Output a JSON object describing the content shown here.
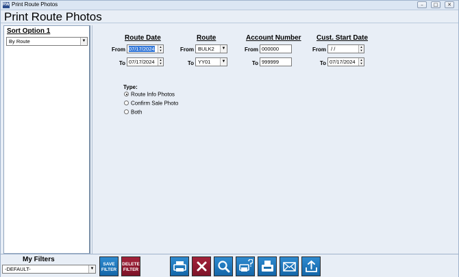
{
  "window": {
    "title": "Print Route Photos",
    "app_icon_text": "RW"
  },
  "page": {
    "title": "Print Route Photos"
  },
  "sort": {
    "label": "Sort Option 1",
    "selected": "By Route"
  },
  "criteria": {
    "route_date": {
      "heading": "Route Date",
      "from_label": "From",
      "to_label": "To",
      "from": "07/17/2024",
      "to": "07/17/2024"
    },
    "route": {
      "heading": "Route",
      "from_label": "From",
      "to_label": "To",
      "from": "BULK2",
      "to": "YY01"
    },
    "account": {
      "heading": "Account Number",
      "from_label": "From",
      "to_label": "To",
      "from": "000000",
      "to": "999999"
    },
    "cust_start": {
      "heading": "Cust. Start Date",
      "from_label": "From",
      "to_label": "To",
      "from": " / /",
      "to": "07/17/2024"
    }
  },
  "type": {
    "label": "Type:",
    "options": [
      "Route Info Photos",
      "Confirm Sale Photo",
      "Both"
    ],
    "selected_index": 0
  },
  "filters": {
    "label": "My Filters",
    "selected": "-DEFAULT-",
    "save_line1": "SAVE",
    "save_line2": "FILTER",
    "delete_line1": "DELETE",
    "delete_line2": "FILTER"
  },
  "toolbar": {
    "icons": [
      "print-icon",
      "cancel-icon",
      "preview-icon",
      "print-setup-icon",
      "fax-icon",
      "email-icon",
      "export-icon"
    ]
  },
  "colors": {
    "toolbar_blue": "#1c74b8",
    "toolbar_red": "#8a1a30",
    "selection": "#3478d8"
  }
}
